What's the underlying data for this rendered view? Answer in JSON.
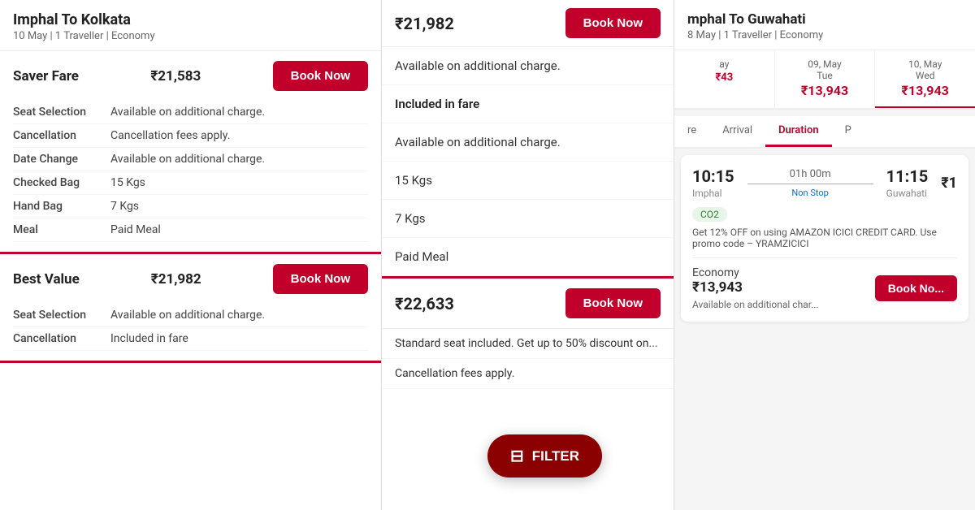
{
  "left": {
    "title": "Imphal To Kolkata",
    "subtitle": "10 May | 1 Traveller | Economy",
    "saver": {
      "name": "Saver Fare",
      "price": "₹21,583",
      "book_label": "Book Now",
      "rows": [
        {
          "label": "Seat Selection",
          "value": "Available on additional charge."
        },
        {
          "label": "Cancellation",
          "value": "Cancellation fees apply."
        },
        {
          "label": "Date Change",
          "value": "Available on additional charge."
        },
        {
          "label": "Checked Bag",
          "value": "15 Kgs"
        },
        {
          "label": "Hand Bag",
          "value": "7 Kgs"
        },
        {
          "label": "Meal",
          "value": "Paid Meal"
        }
      ]
    },
    "best_value": {
      "name": "Best Value",
      "price": "₹21,982",
      "book_label": "Book Now",
      "rows": [
        {
          "label": "Seat Selection",
          "value": "Available on additional charge."
        },
        {
          "label": "Cancellation",
          "value": "Included in fare"
        }
      ]
    }
  },
  "middle": {
    "top_price": "₹21,982",
    "book_label": "Book Now",
    "items": [
      "Available on additional charge.",
      "Included in fare",
      "Available on additional charge.",
      "15 Kgs",
      "7 Kgs",
      "Paid Meal"
    ],
    "bottom_price": "₹22,633",
    "book_label2": "Book Now",
    "bottom_items": [
      "Standard seat included. Get up to 50% discount on...",
      "Cancellation fees apply."
    ]
  },
  "right": {
    "title": "mphal To Guwahati",
    "subtitle": "8 May | 1 Traveller | Economy",
    "dates": [
      {
        "day": "ay",
        "label": "",
        "price": "₹43"
      },
      {
        "day": "09, May",
        "label": "Tue",
        "price": "₹13,943"
      },
      {
        "day": "10, May",
        "label": "Wed",
        "price": "₹13,943"
      }
    ],
    "tabs": [
      {
        "label": "re",
        "active": false
      },
      {
        "label": "Arrival",
        "active": false
      },
      {
        "label": "Duration",
        "active": true
      },
      {
        "label": "P",
        "active": false
      }
    ],
    "flight": {
      "depart_time": "10:15",
      "depart_airport": "Imphal",
      "duration": "01h 00m",
      "stop": "Non Stop",
      "arrive_time": "11:15",
      "arrive_airport": "Guwahati",
      "price_partial": "₹1",
      "co2_label": "CO2",
      "promo": "Get 12% OFF on using AMAZON ICICI CREDIT CARD. Use promo code – YRAMZICICI",
      "economy_label": "Economy",
      "economy_price": "₹13,943",
      "book_label": "Book No",
      "avail_text": "Available on additional char..."
    }
  },
  "filter": {
    "label": "FILTER",
    "icon": "⊟"
  }
}
